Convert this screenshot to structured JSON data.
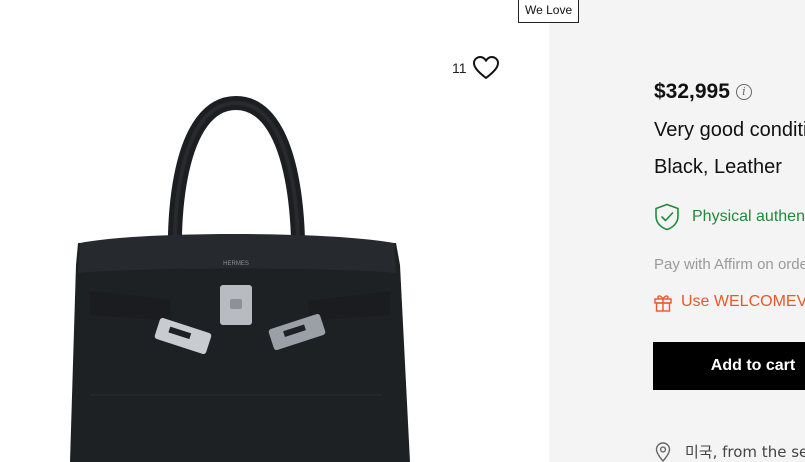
{
  "badge": {
    "label": "We Love"
  },
  "favorite": {
    "count": "11",
    "icon": "heart-outline-icon"
  },
  "product": {
    "price": "$32,995",
    "condition": "Very good condition",
    "color_material": "Black, Leather",
    "authentication": "Physical authentication",
    "financing": "Pay with Affirm on orders",
    "promo": "Use WELCOMEVC",
    "cta_label": "Add to cart",
    "shipping": "미국, from the seller"
  },
  "icons": {
    "info": "info-icon",
    "shield": "shield-check-icon",
    "gift": "gift-icon",
    "location": "location-pin-icon"
  },
  "colors": {
    "panel_bg": "#f4f4f4",
    "auth_green": "#1f8a3a",
    "promo_orange": "#e8582b",
    "cta_bg": "#000000"
  }
}
